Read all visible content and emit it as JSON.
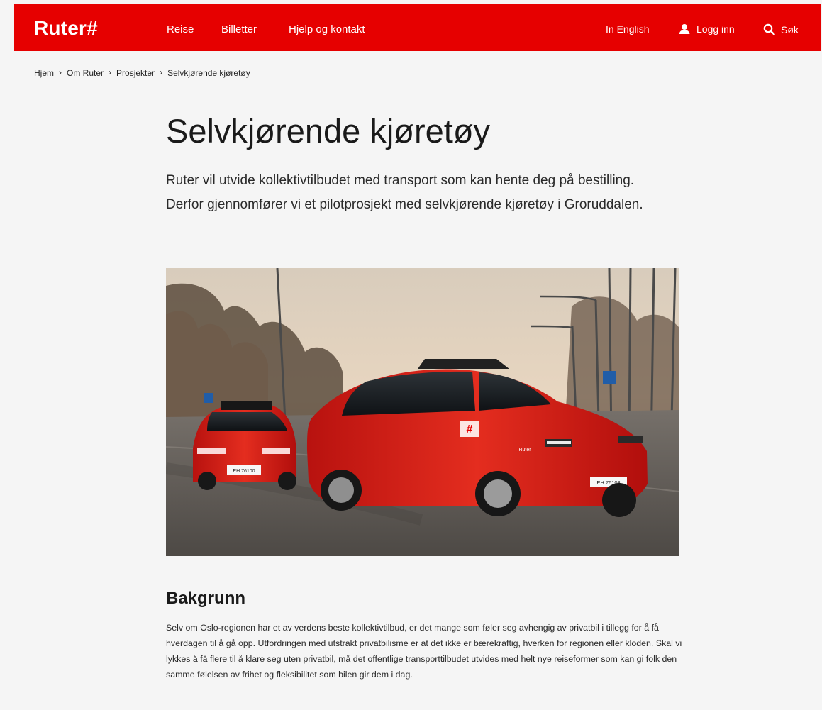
{
  "header": {
    "logo": "Ruter#",
    "nav": {
      "reise": "Reise",
      "billetter": "Billetter",
      "hjelp": "Hjelp og kontakt",
      "english": "In English",
      "login": "Logg inn",
      "search": "Søk"
    }
  },
  "breadcrumb": {
    "items": [
      "Hjem",
      "Om Ruter",
      "Prosjekter",
      "Selvkjørende kjøretøy"
    ]
  },
  "page": {
    "title": "Selvkjørende kjøretøy",
    "intro": "Ruter vil utvide kollektivtilbudet med transport som kan hente deg på bestilling. Derfor gjennomfører vi et pilotprosjekt med selvkjørende kjøretøy i Groruddalen."
  },
  "hero": {
    "plate_front": "EH 76103",
    "plate_back": "EH 76100"
  },
  "section": {
    "title": "Bakgrunn",
    "body": "Selv om Oslo-regionen har et av verdens beste kollektivtilbud, er det mange som føler seg avhengig av privatbil i tillegg for å få hverdagen til å gå opp. Utfordringen med utstrakt privatbilisme er at det ikke er bærekraftig, hverken for regionen eller kloden. Skal vi lykkes å få flere til å klare seg uten privatbil, må det offentlige transporttilbudet utvides med helt nye reiseformer som kan gi folk den samme følelsen av frihet og fleksibilitet som bilen gir dem i dag."
  },
  "colors": {
    "brand": "#e60000",
    "background": "#f5f5f5",
    "text": "#1a1a1a"
  },
  "icons": {
    "user": "user-icon",
    "search": "search-icon",
    "chevron": "chevron-right-icon"
  }
}
